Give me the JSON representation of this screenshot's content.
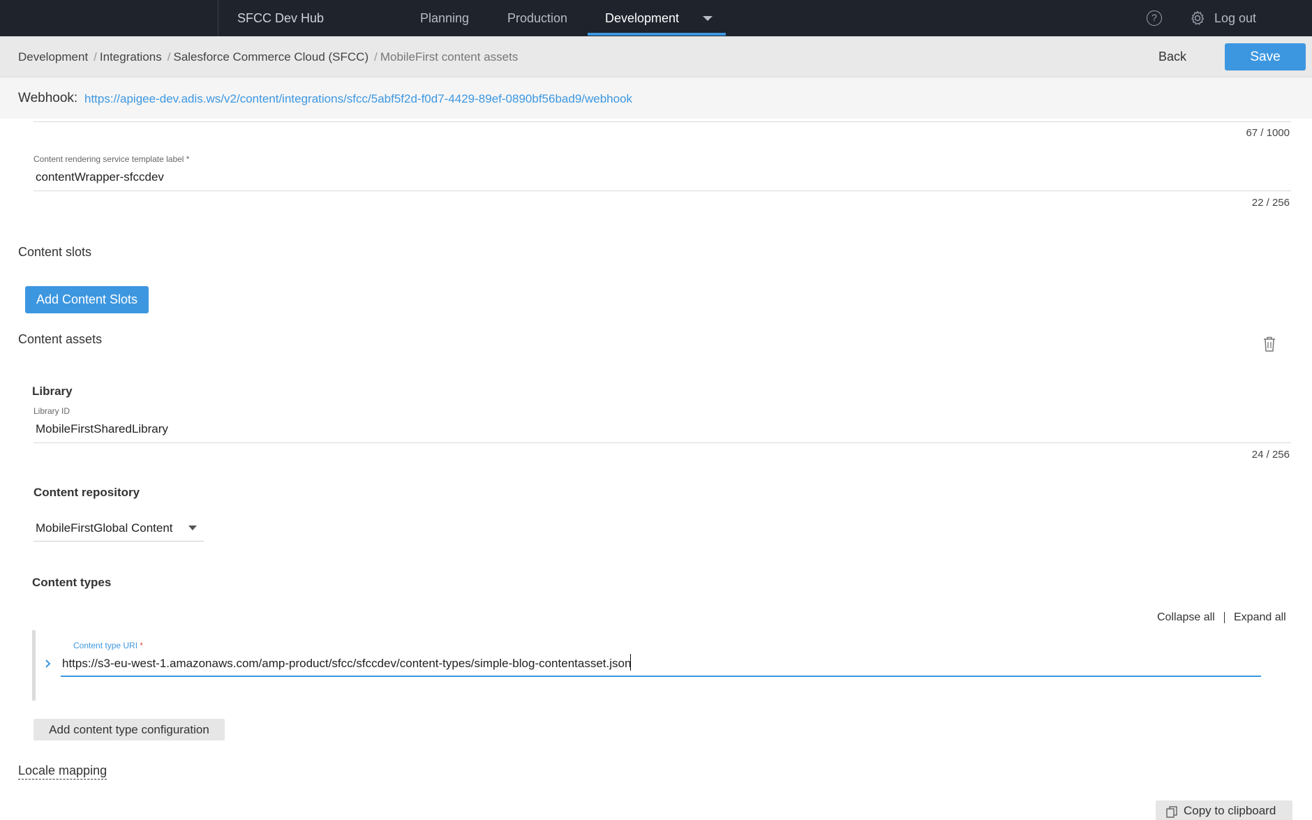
{
  "topnav": {
    "brand": "SFCC Dev Hub",
    "items": [
      {
        "label": "Planning"
      },
      {
        "label": "Production"
      },
      {
        "label": "Development"
      }
    ],
    "logout": "Log out",
    "help_glyph": "?"
  },
  "breadcrumb": {
    "items": [
      "Development",
      "Integrations",
      "Salesforce Commerce Cloud (SFCC)",
      "MobileFirst content assets"
    ],
    "separator": "/"
  },
  "actions": {
    "back": "Back",
    "save": "Save"
  },
  "webhook": {
    "label": "Webhook:",
    "url": "https://apigee-dev.adis.ws/v2/content/integrations/sfcc/5abf5f2d-f0d7-4429-89ef-0890bf56bad9/webhook"
  },
  "form": {
    "prev_counter": "67 / 1000",
    "template_label": {
      "label": "Content rendering service template label *",
      "value": "contentWrapper-sfccdev",
      "counter": "22 / 256"
    },
    "content_slots": {
      "title": "Content slots",
      "add_button": "Add Content Slots"
    },
    "content_assets": {
      "title": "Content assets",
      "library_title": "Library",
      "library_id": {
        "label": "Library ID",
        "value": "MobileFirstSharedLibrary",
        "counter": "24 / 256"
      },
      "repository": {
        "title": "Content repository",
        "selected": "MobileFirstGlobal Content"
      },
      "content_types": {
        "title": "Content types",
        "collapse_all": "Collapse all",
        "expand_all": "Expand all",
        "uri_label": "Content type URI",
        "uri_required": "*",
        "uri_value": "https://s3-eu-west-1.amazonaws.com/amp-product/sfcc/sfccdev/content-types/simple-blog-contentasset.json",
        "add_button": "Add content type configuration"
      }
    },
    "locale_mapping": "Locale mapping",
    "copy_button": "Copy to clipboard"
  },
  "colors": {
    "accent": "#3d97e0",
    "topbar": "#1f232c",
    "required": "#d9534f"
  },
  "icons": [
    "help-icon",
    "gear-icon",
    "chevron-down-icon",
    "trash-icon",
    "chevron-right-icon",
    "copy-icon"
  ]
}
